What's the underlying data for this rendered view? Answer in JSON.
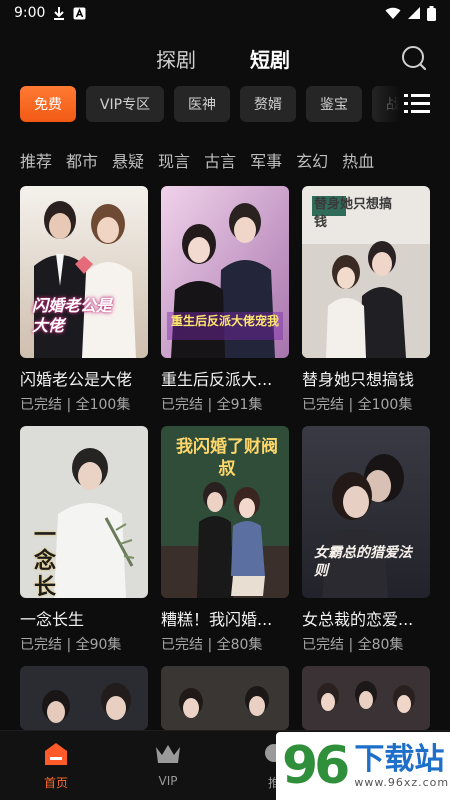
{
  "status_bar": {
    "time": "9:00",
    "icons": [
      "download-icon",
      "a-box-icon",
      "wifi-icon",
      "signal-icon",
      "battery-icon"
    ]
  },
  "top_tabs": [
    {
      "label": "探剧",
      "active": false
    },
    {
      "label": "短剧",
      "active": true
    }
  ],
  "chips": [
    {
      "label": "免费",
      "active": true
    },
    {
      "label": "VIP专区",
      "active": false
    },
    {
      "label": "医神",
      "active": false
    },
    {
      "label": "赘婿",
      "active": false
    },
    {
      "label": "鉴宝",
      "active": false
    },
    {
      "label": "战神",
      "active": false
    }
  ],
  "genres": [
    "推荐",
    "都市",
    "悬疑",
    "现言",
    "古言",
    "军事",
    "玄幻",
    "热血"
  ],
  "dramas": [
    {
      "title": "闪婚老公是大佬",
      "status": "已完结 | 全100集",
      "poster_text": "闪婚老公是大佬",
      "colors": [
        "#f3efe9",
        "#c9b8a8"
      ]
    },
    {
      "title": "重生后反派大...",
      "status": "已完结 | 全91集",
      "poster_text": "重生后反派大佬宠我",
      "colors": [
        "#e6c8e4",
        "#b07fb6"
      ]
    },
    {
      "title": "替身她只想搞钱",
      "status": "已完结 | 全100集",
      "poster_text": "替身她只想搞钱",
      "colors": [
        "#e9e6e3",
        "#cfc8c2"
      ]
    },
    {
      "title": "一念长生",
      "status": "已完结 | 全90集",
      "poster_text": "一念长生",
      "colors": [
        "#d8d8d4",
        "#a9aba5"
      ]
    },
    {
      "title": "糟糕！我闪婚...",
      "status": "已完结 | 全80集",
      "poster_text": "我闪婚了财阀叔",
      "colors": [
        "#2f4f3a",
        "#1e3426"
      ]
    },
    {
      "title": "女总裁的恋爱...",
      "status": "已完结 | 全80集",
      "poster_text": "女霸总的猎爱法则",
      "colors": [
        "#2e2e35",
        "#4a4a55"
      ]
    },
    {
      "title": "",
      "status": "",
      "poster_text": "",
      "colors": [
        "#2a2b30",
        "#3b3c44"
      ]
    },
    {
      "title": "",
      "status": "",
      "poster_text": "",
      "colors": [
        "#3a3633",
        "#55504b"
      ]
    },
    {
      "title": "",
      "status": "",
      "poster_text": "",
      "colors": [
        "#3b3235",
        "#6a5a5e"
      ]
    }
  ],
  "bottom_nav": [
    {
      "label": "首页",
      "icon": "home-icon",
      "active": true
    },
    {
      "label": "VIP",
      "icon": "crown-icon",
      "active": false
    },
    {
      "label": "推",
      "icon": "recommend-icon",
      "active": false
    }
  ],
  "watermark": {
    "number": "96",
    "text": "下载站",
    "url": "www.96xz.com"
  },
  "accent": "#ff6a2a"
}
